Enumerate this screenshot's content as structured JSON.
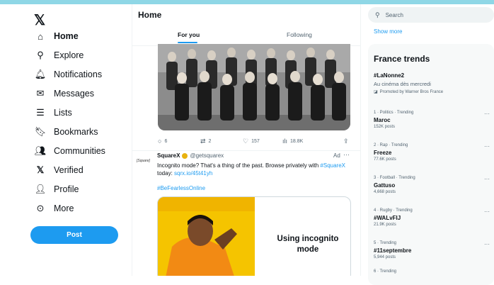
{
  "nav": {
    "items": [
      {
        "label": "Home",
        "icon": "home-icon"
      },
      {
        "label": "Explore",
        "icon": "search-icon"
      },
      {
        "label": "Notifications",
        "icon": "bell-icon"
      },
      {
        "label": "Messages",
        "icon": "envelope-icon"
      },
      {
        "label": "Lists",
        "icon": "list-icon"
      },
      {
        "label": "Bookmarks",
        "icon": "bookmark-icon"
      },
      {
        "label": "Communities",
        "icon": "people-icon"
      },
      {
        "label": "Verified",
        "icon": "x-logo-icon"
      },
      {
        "label": "Profile",
        "icon": "person-icon"
      },
      {
        "label": "More",
        "icon": "more-circle-icon"
      }
    ],
    "post_button": "Post"
  },
  "timeline": {
    "title": "Home",
    "tabs": [
      "For you",
      "Following"
    ],
    "tweet_actions": {
      "replies": "6",
      "reposts": "2",
      "likes": "157",
      "views": "18.8K"
    },
    "ad_tweet": {
      "avatar_text": "[Square]",
      "name": "SquareX",
      "handle": "@getsquarex",
      "ad_label": "Ad",
      "more": "···",
      "text_part1": "Incognito mode? That's a thing of the past. Browse privately with ",
      "mention": "#SquareX",
      "text_part2": " today: ",
      "link": "sqrx.io/45t41yh",
      "hashtag": "#BeFearlessOnline",
      "meme_caption": "Using incognito mode"
    }
  },
  "sidebar": {
    "search_placeholder": "Search",
    "show_more": "Show more",
    "trends_title": "France trends",
    "promoted": {
      "tag": "#LaNonne2",
      "description": "Au cinéma dès mercredi",
      "promoted_by": "Promoted by Warner Bros France"
    },
    "trends": [
      {
        "meta": "1 · Politics · Trending",
        "name": "Maroc",
        "posts": "152K posts"
      },
      {
        "meta": "2 · Rap · Trending",
        "name": "Freeze",
        "posts": "77.6K posts"
      },
      {
        "meta": "3 · Football · Trending",
        "name": "Gattuso",
        "posts": "4,668 posts"
      },
      {
        "meta": "4 · Rugby · Trending",
        "name": "#WALvFIJ",
        "posts": "21.9K posts"
      },
      {
        "meta": "5 · Trending",
        "name": "#11septembre",
        "posts": "5,944 posts"
      },
      {
        "meta": "6 · Trending",
        "name": "",
        "posts": ""
      }
    ],
    "more_dots": "···"
  },
  "colors": {
    "accent": "#1d9bf0",
    "meme_orange": "#f28a14",
    "meme_yellow": "#f5c400"
  }
}
